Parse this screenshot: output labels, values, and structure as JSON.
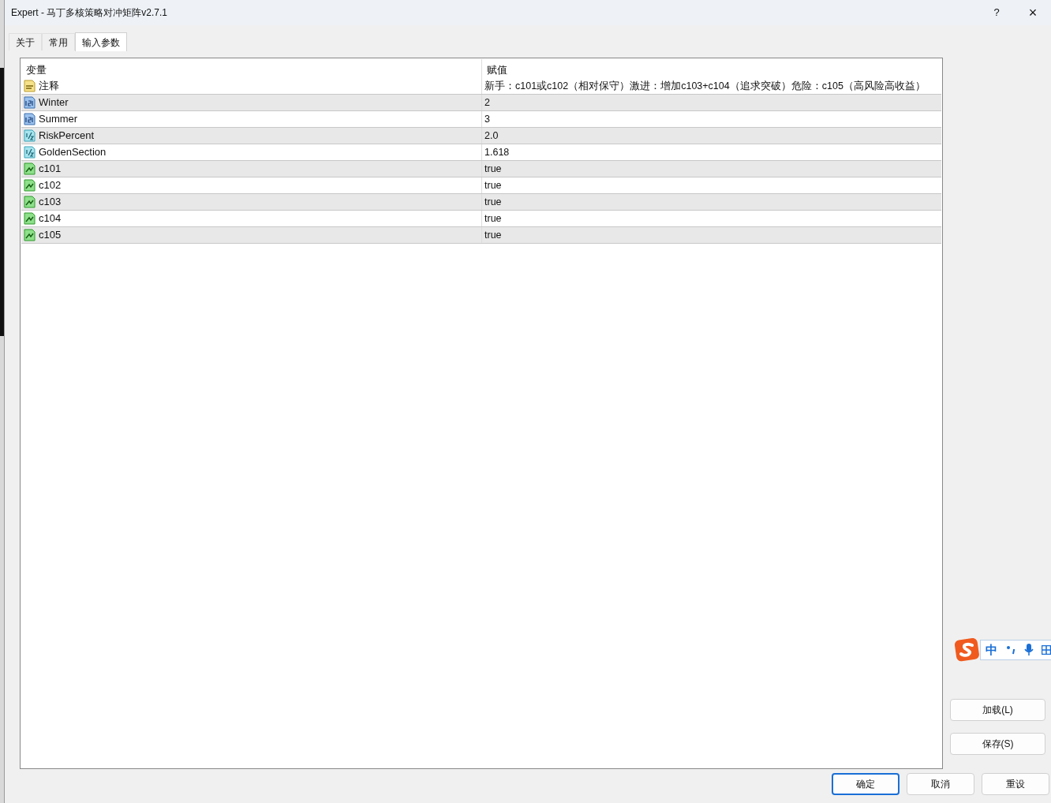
{
  "window": {
    "title": "Expert - 马丁多核策略对冲矩阵v2.7.1",
    "help": "?",
    "close": "×"
  },
  "tabs": [
    {
      "label": "关于",
      "selected": false
    },
    {
      "label": "常用",
      "selected": false
    },
    {
      "label": "输入参数",
      "selected": true
    }
  ],
  "table": {
    "columns": [
      "变量",
      "赋值"
    ],
    "rows": [
      {
        "kind": "string",
        "name": "注释",
        "value": "新手：c101或c102（相对保守）激进：增加c103+c104（追求突破）危险：c105（高风险高收益）"
      },
      {
        "kind": "int",
        "name": "Winter",
        "value": "2"
      },
      {
        "kind": "int",
        "name": "Summer",
        "value": "3"
      },
      {
        "kind": "double",
        "name": "RiskPercent",
        "value": "2.0"
      },
      {
        "kind": "double",
        "name": "GoldenSection",
        "value": "1.618"
      },
      {
        "kind": "bool",
        "name": "c101",
        "value": "true"
      },
      {
        "kind": "bool",
        "name": "c102",
        "value": "true"
      },
      {
        "kind": "bool",
        "name": "c103",
        "value": "true"
      },
      {
        "kind": "bool",
        "name": "c104",
        "value": "true"
      },
      {
        "kind": "bool",
        "name": "c105",
        "value": "true"
      }
    ]
  },
  "ime_bar": {
    "mode": "中"
  },
  "side_buttons": [
    "加载(L)",
    "保存(S)"
  ],
  "bottom_buttons": [
    {
      "label": "确定",
      "selected": true
    },
    {
      "label": "取消",
      "selected": false
    },
    {
      "label": "重设",
      "selected": false
    }
  ]
}
